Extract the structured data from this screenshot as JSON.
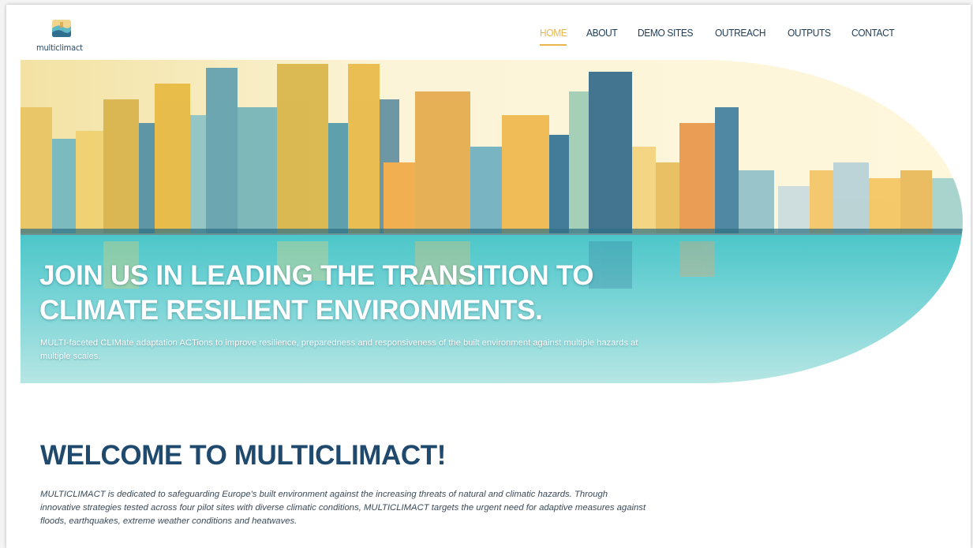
{
  "logo": {
    "name": "multiclimact"
  },
  "nav": {
    "items": [
      {
        "label": "HOME"
      },
      {
        "label": "ABOUT"
      },
      {
        "label": "DEMO SITES"
      },
      {
        "label": "OUTREACH"
      },
      {
        "label": "OUTPUTS"
      },
      {
        "label": "CONTACT"
      }
    ]
  },
  "hero": {
    "title_line1": "JOIN US IN LEADING THE TRANSITION TO",
    "title_line2": "CLIMATE RESILIENT ENVIRONMENTS.",
    "subtitle": "MULTI-faceted CLIMate adaptation ACTions to improve resilience, preparedness and responsiveness of the built environment against multiple hazards at multiple scales."
  },
  "welcome": {
    "title": "WELCOME TO MULTICLIMACT!",
    "text": "MULTICLIMACT is dedicated to safeguarding Europe's built environment against the increasing threats of natural and climatic hazards. Through innovative strategies tested across four pilot sites with diverse climatic conditions, MULTICLIMACT targets the urgent need for adaptive measures against floods, earthquakes, extreme weather conditions and heatwaves."
  },
  "colors": {
    "accent": "#e8b64a",
    "navy": "#1f4a6e",
    "teal": "#3fc3cb"
  }
}
